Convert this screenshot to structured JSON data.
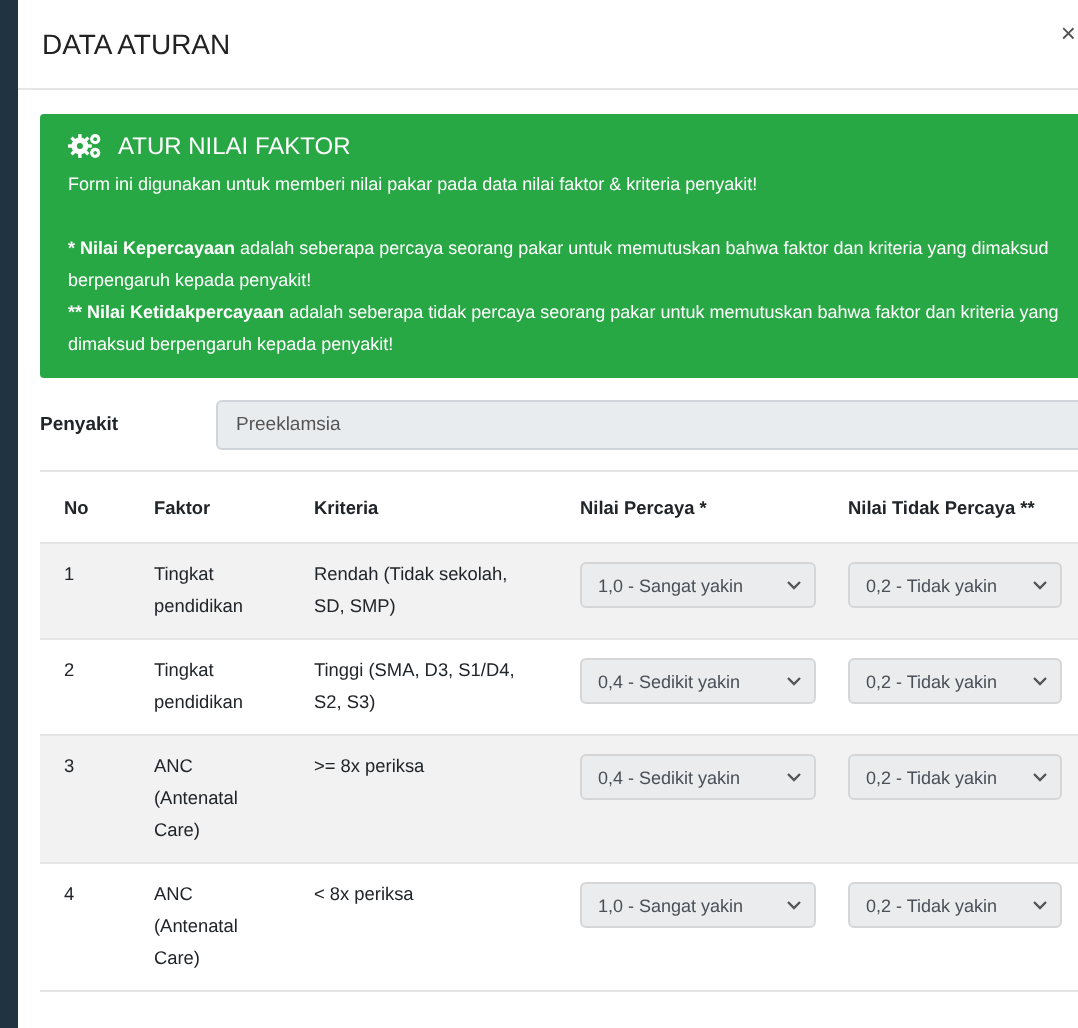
{
  "modal": {
    "title": "DATA ATURAN",
    "close": "×"
  },
  "alert": {
    "title": "ATUR NILAI FAKTOR",
    "intro": "Form ini digunakan untuk memberi nilai pakar pada data nilai faktor & kriteria penyakit!",
    "notes": [
      {
        "term": "* Nilai Kepercayaan",
        "text": " adalah seberapa percaya seorang pakar untuk memutuskan bahwa faktor dan kriteria yang dimaksud berpengaruh kepada penyakit!"
      },
      {
        "term": "** Nilai Ketidakpercayaan",
        "text": " adalah seberapa tidak percaya seorang pakar untuk memutuskan bahwa faktor dan kriteria yang dimaksud berpengaruh kepada penyakit!"
      }
    ]
  },
  "penyakit": {
    "label": "Penyakit",
    "value": "Preeklamsia"
  },
  "table": {
    "columns": [
      "No",
      "Faktor",
      "Kriteria",
      "Nilai Percaya *",
      "Nilai Tidak Percaya **"
    ],
    "rows": [
      {
        "no": "1",
        "faktor": "Tingkat pendidikan",
        "kriteria": "Rendah (Tidak sekolah, SD, SMP)",
        "percaya": "1,0 - Sangat yakin",
        "tidak_percaya": "0,2 - Tidak yakin"
      },
      {
        "no": "2",
        "faktor": "Tingkat pendidikan",
        "kriteria": "Tinggi (SMA, D3, S1/D4, S2, S3)",
        "percaya": "0,4 - Sedikit yakin",
        "tidak_percaya": "0,2 - Tidak yakin"
      },
      {
        "no": "3",
        "faktor": "ANC (Antenatal Care)",
        "kriteria": ">= 8x periksa",
        "percaya": "0,4 - Sedikit yakin",
        "tidak_percaya": "0,2 - Tidak yakin"
      },
      {
        "no": "4",
        "faktor": "ANC (Antenatal Care)",
        "kriteria": "< 8x periksa",
        "percaya": "1,0 - Sangat yakin",
        "tidak_percaya": "0,2 - Tidak yakin"
      }
    ]
  }
}
